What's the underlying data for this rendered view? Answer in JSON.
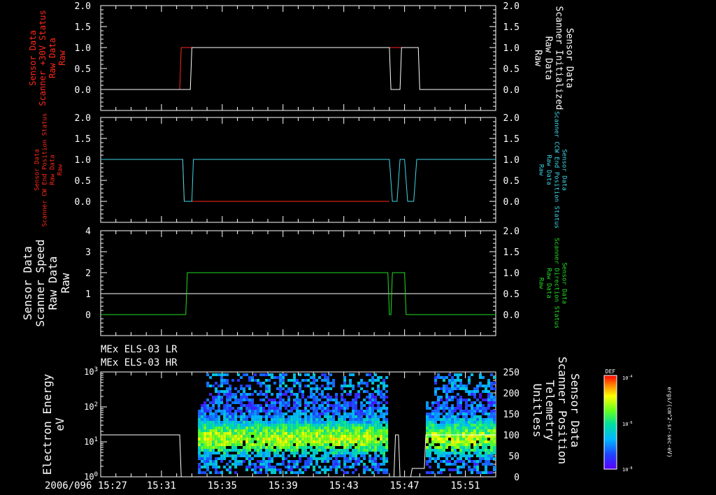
{
  "colors": {
    "background": "#000000",
    "axis": "#ffffff",
    "red": "#ff2a1a",
    "cyan": "#3fd6e8",
    "green": "#22dd22",
    "white": "#ffffff"
  },
  "time_axis": {
    "start": "2006/096 15:27",
    "end": "15:53",
    "tick_labels": [
      "2006/096 15:27",
      "15:31",
      "15:35",
      "15:39",
      "15:43",
      "15:47",
      "15:51"
    ]
  },
  "chart_data": [
    {
      "type": "line",
      "panel": 1,
      "ylabel_left": [
        "Sensor Data",
        "Scanner +30V Status",
        "Raw Data",
        "Raw"
      ],
      "ylabel_right": [
        "Sensor Data",
        "Scanner Initialized",
        "Raw Data",
        "Raw"
      ],
      "left_ylim": [
        -0.5,
        2.0
      ],
      "left_ticks": [
        "2.0",
        "1.5",
        "1.0",
        "0.5",
        "0.0"
      ],
      "right_ylim": [
        -0.5,
        2.0
      ],
      "right_ticks": [
        "2.0",
        "1.5",
        "1.0",
        "0.5",
        "0.0"
      ],
      "series": [
        {
          "color": "red",
          "axis": "left",
          "x": [
            "15:27",
            "15:32.2",
            "15:32.3",
            "15:44.8",
            "15:44.9",
            "15:46.0",
            "15:46.1",
            "15:47.0"
          ],
          "y": [
            0,
            0,
            1,
            1,
            1,
            1,
            1,
            1
          ]
        },
        {
          "color": "white",
          "axis": "right",
          "x": [
            "15:27",
            "15:32.9",
            "15:33.0",
            "15:46.0",
            "15:46.1",
            "15:46.7",
            "15:46.8",
            "15:47.9",
            "15:48.0",
            "15:53"
          ],
          "y": [
            0,
            0,
            1,
            1,
            0,
            0,
            1,
            1,
            0,
            0
          ]
        }
      ]
    },
    {
      "type": "line",
      "panel": 2,
      "ylabel_left": [
        "Sensor Data",
        "Scanner CW End Position Status",
        "Raw Data",
        "Raw"
      ],
      "ylabel_right": [
        "Sensor Data",
        "Scanner CCW End Position Status",
        "Raw Data",
        "Raw"
      ],
      "left_ylim": [
        -0.5,
        2.0
      ],
      "left_ticks": [
        "2.0",
        "1.5",
        "1.0",
        "0.5",
        "0.0"
      ],
      "right_ylim": [
        -0.5,
        2.0
      ],
      "right_ticks": [
        "2.0",
        "1.5",
        "1.0",
        "0.5",
        "0.0"
      ],
      "series": [
        {
          "color": "red",
          "axis": "left",
          "x": [
            "15:27",
            "15:32.4",
            "15:32.5",
            "15:46.0"
          ],
          "y": [
            1,
            1,
            0,
            0
          ]
        },
        {
          "color": "cyan",
          "axis": "right",
          "x": [
            "15:27",
            "15:32.4",
            "15:32.5",
            "15:33.0",
            "15:33.1",
            "15:46.0",
            "15:46.2",
            "15:46.5",
            "15:46.7",
            "15:47.0",
            "15:47.2",
            "15:47.6",
            "15:47.8",
            "15:53"
          ],
          "y": [
            1,
            1,
            0,
            0,
            1,
            1,
            0,
            0,
            1,
            1,
            0,
            0,
            1,
            1
          ]
        }
      ]
    },
    {
      "type": "line",
      "panel": 3,
      "ylabel_left": [
        "Sensor Data",
        "Scanner Speed",
        "Raw Data",
        "Raw"
      ],
      "ylabel_right": [
        "Sensor Data",
        "Scanner Direction Status",
        "Raw Data",
        "Raw"
      ],
      "left_ylim": [
        -1,
        4
      ],
      "left_ticks": [
        "4",
        "3",
        "2",
        "1",
        "0"
      ],
      "right_ylim": [
        -0.5,
        2.0
      ],
      "right_ticks": [
        "2.0",
        "1.5",
        "1.0",
        "0.5",
        "0.0"
      ],
      "series": [
        {
          "color": "white",
          "axis": "left",
          "x": [
            "15:27",
            "15:53"
          ],
          "y": [
            1,
            1
          ]
        },
        {
          "color": "green",
          "axis": "right",
          "x": [
            "15:27",
            "15:32.6",
            "15:32.7",
            "15:45.9",
            "15:46.0",
            "15:46.1",
            "15:46.2",
            "15:47.0",
            "15:47.1",
            "15:53"
          ],
          "y": [
            0,
            0,
            1,
            1,
            0,
            0,
            1,
            1,
            0,
            0
          ]
        }
      ]
    },
    {
      "type": "heatmap",
      "panel": 4,
      "titles": [
        "MEx ELS-03 LR",
        "MEx ELS-03 HR"
      ],
      "ylabel_left": [
        "Electron Energy",
        "eV"
      ],
      "ylabel_right": [
        "Sensor Data",
        "Scanner Position",
        "Telemetry",
        "Unitless"
      ],
      "left_scale": "log",
      "left_ylim": [
        1,
        1000
      ],
      "left_ticks": [
        "10^3",
        "10^2",
        "10^1",
        "10^0"
      ],
      "right_ylim": [
        0,
        250
      ],
      "right_ticks": [
        "250",
        "200",
        "150",
        "100",
        "50",
        "0"
      ],
      "data_intervals": [
        [
          "15:33.4",
          "15:45.8"
        ],
        [
          "15:48.4",
          "15:53"
        ]
      ],
      "series": [
        {
          "color": "white",
          "axis": "right",
          "x": [
            "15:27",
            "15:32.2",
            "15:32.3",
            "15:46.3",
            "15:46.4",
            "15:46.6",
            "15:46.7",
            "15:47.4",
            "15:47.5",
            "15:48.3",
            "15:48.4",
            "15:53"
          ],
          "y": [
            100,
            100,
            0,
            0,
            100,
            100,
            0,
            0,
            20,
            20,
            100,
            100
          ]
        }
      ],
      "colorbar": {
        "label": "DEF",
        "unit": "ergs/(cm^2-sr-sec-eV)",
        "ticks": [
          "10^-4",
          "10^-6",
          "10^-8"
        ],
        "range": [
          "1e-8",
          "1e-4"
        ]
      }
    }
  ]
}
